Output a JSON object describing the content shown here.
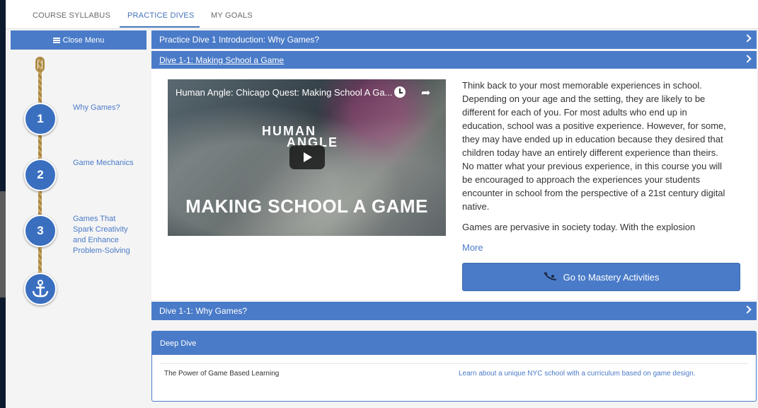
{
  "tabs": [
    "COURSE SYLLABUS",
    "PRACTICE DIVES",
    "MY GOALS"
  ],
  "active_tab": "PRACTICE DIVES",
  "sidebar": {
    "menu_label": "Close Menu",
    "steps": [
      {
        "number": "1",
        "label": "Why Games?"
      },
      {
        "number": "2",
        "label": "Game Mechanics"
      },
      {
        "number": "3",
        "label": "Games That Spark Creativity and Enhance Problem-Solving"
      }
    ]
  },
  "accordion": {
    "intro": "Practice Dive 1 Introduction: Why Games?",
    "dive_1_1": "Dive 1-1: Making School a Game",
    "dive_1_1b": "Dive 1-1: Why Games?"
  },
  "video": {
    "title": "Human Angle: Chicago Quest: Making School A Ga...",
    "logo_line1": "HUMAN",
    "logo_line2": "ANGLE",
    "headline": "MAKING SCHOOL A GAME"
  },
  "body": {
    "paragraph1": "Think back to your most memorable experiences in school.  Depending on your age and the setting, they are likely to be different for each of you.  For most adults who end up in education, school was a positive experience.  However, for some, they may have ended up in education because they desired that children today have an entirely different experience than theirs.  No matter what your previous experience, in this course you will be encouraged to approach the experiences your students encounter in school from the perspective of a 21st century digital native.",
    "paragraph2": "Games are pervasive in society today.  With the explosion",
    "more": "More",
    "mastery_button": "Go to Mastery Activities"
  },
  "deep_dive": {
    "header": "Deep Dive",
    "item_name": "The Power of Game Based Learning",
    "item_desc": "Learn about a unique NYC school with a curriculum based on game design."
  },
  "colors": {
    "accent": "#4a7bc8",
    "step_circle": "#3a6fc0",
    "rope": "#c9a865"
  }
}
